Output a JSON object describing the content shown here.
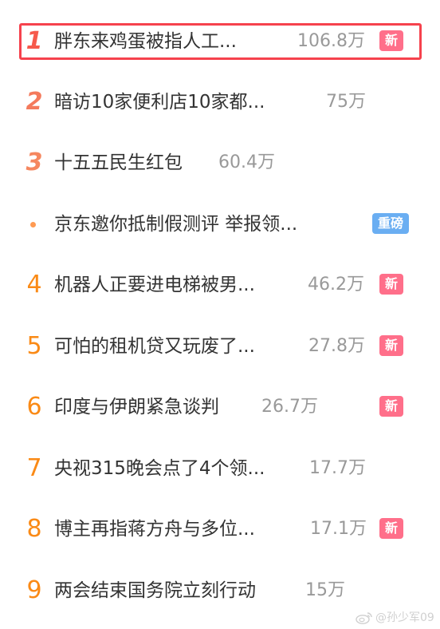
{
  "hot_search": {
    "items": [
      {
        "rank": "1",
        "title": "胖东来鸡蛋被指人工...",
        "count": "106.8万",
        "badge": "新"
      },
      {
        "rank": "2",
        "title": "暗访10家便利店10家都...",
        "count": "75万",
        "badge": ""
      },
      {
        "rank": "3",
        "title": "十五五民生红包",
        "count": "60.4万",
        "badge": ""
      },
      {
        "rank": "",
        "title": "京东邀你抵制假测评 举报领...",
        "count": "",
        "badge": "重磅"
      },
      {
        "rank": "4",
        "title": "机器人正要进电梯被男...",
        "count": "46.2万",
        "badge": "新"
      },
      {
        "rank": "5",
        "title": "可怕的租机贷又玩废了...",
        "count": "27.8万",
        "badge": "新"
      },
      {
        "rank": "6",
        "title": "印度与伊朗紧急谈判",
        "count": "26.7万",
        "badge": "新"
      },
      {
        "rank": "7",
        "title": "央视315晚会点了4个领...",
        "count": "17.7万",
        "badge": ""
      },
      {
        "rank": "8",
        "title": "博主再指蒋方舟与多位...",
        "count": "17.1万",
        "badge": "新"
      },
      {
        "rank": "9",
        "title": "两会结束国务院立刻行动",
        "count": "15万",
        "badge": ""
      }
    ]
  },
  "watermark": {
    "text": "@孙少军09"
  },
  "colors": {
    "highlight_border": "#f6424d",
    "rank_top": "#f65a4c",
    "rank_plain": "#fa8a16",
    "badge_new": "#ff6f8a",
    "badge_hot": "#6aaef2"
  }
}
